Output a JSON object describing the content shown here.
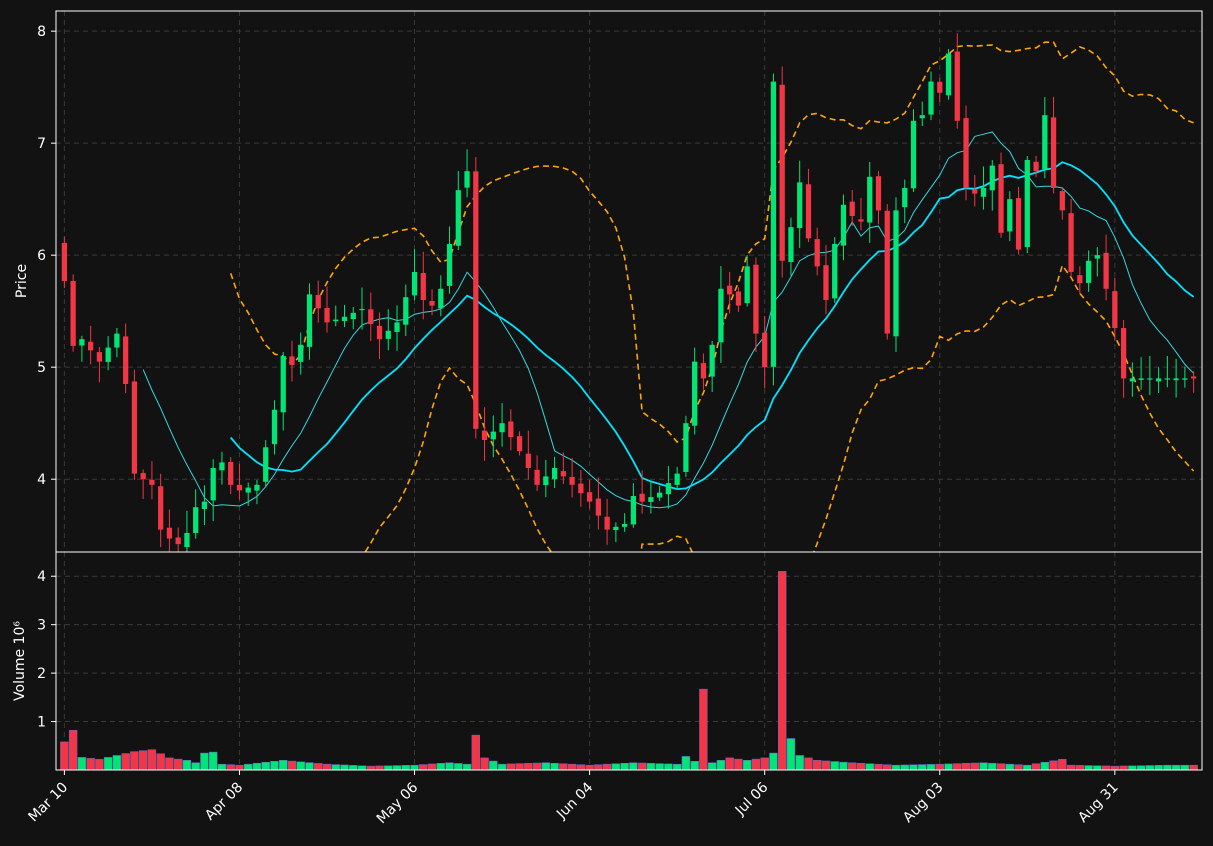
{
  "colors": {
    "background": "#121212",
    "up": "#00e676",
    "down": "#f23645",
    "sma_fast": "#33d6e0",
    "sma_slow": "#00e5ff",
    "bollinger": "#ffa500",
    "grid": "#3a3a3a",
    "text": "#ffffff"
  },
  "chart_data": [
    {
      "type": "candlestick",
      "ylabel": "Price",
      "ylim": [
        3.35,
        8.18
      ],
      "yticks": [
        4,
        5,
        6,
        7,
        8
      ],
      "grid": true,
      "x_count": 130,
      "x_ticks": [
        {
          "index": 0,
          "label": "Mar 10"
        },
        {
          "index": 20,
          "label": "Apr 08"
        },
        {
          "index": 40,
          "label": "May 06"
        },
        {
          "index": 60,
          "label": "Jun 04"
        },
        {
          "index": 80,
          "label": "Jul 06"
        },
        {
          "index": 100,
          "label": "Aug 03"
        },
        {
          "index": 120,
          "label": "Aug 31"
        }
      ],
      "close_anchors": [
        [
          0,
          5.77
        ],
        [
          1,
          5.19
        ],
        [
          2,
          5.25
        ],
        [
          4,
          5.05
        ],
        [
          6,
          5.3
        ],
        [
          7,
          4.85
        ],
        [
          8,
          4.05
        ],
        [
          10,
          3.95
        ],
        [
          11,
          3.55
        ],
        [
          12,
          3.47
        ],
        [
          13,
          3.42
        ],
        [
          14,
          3.52
        ],
        [
          15,
          3.75
        ],
        [
          16,
          3.8
        ],
        [
          17,
          4.1
        ],
        [
          18,
          4.15
        ],
        [
          19,
          3.95
        ],
        [
          20,
          3.9
        ],
        [
          22,
          3.95
        ],
        [
          24,
          4.62
        ],
        [
          25,
          5.1
        ],
        [
          26,
          5.02
        ],
        [
          27,
          5.2
        ],
        [
          28,
          5.65
        ],
        [
          30,
          5.4
        ],
        [
          32,
          5.45
        ],
        [
          34,
          5.52
        ],
        [
          36,
          5.25
        ],
        [
          38,
          5.4
        ],
        [
          40,
          5.85
        ],
        [
          41,
          5.6
        ],
        [
          42,
          5.55
        ],
        [
          43,
          5.7
        ],
        [
          44,
          6.1
        ],
        [
          45,
          6.58
        ],
        [
          46,
          6.75
        ],
        [
          47,
          4.45
        ],
        [
          48,
          4.35
        ],
        [
          50,
          4.5
        ],
        [
          52,
          4.25
        ],
        [
          54,
          3.95
        ],
        [
          56,
          4.1
        ],
        [
          58,
          3.95
        ],
        [
          60,
          3.8
        ],
        [
          62,
          3.55
        ],
        [
          64,
          3.6
        ],
        [
          65,
          3.85
        ],
        [
          66,
          3.8
        ],
        [
          68,
          3.88
        ],
        [
          70,
          4.05
        ],
        [
          71,
          4.5
        ],
        [
          72,
          5.05
        ],
        [
          73,
          4.9
        ],
        [
          74,
          5.2
        ],
        [
          75,
          5.7
        ],
        [
          76,
          5.65
        ],
        [
          77,
          5.55
        ],
        [
          78,
          5.9
        ],
        [
          79,
          5.3
        ],
        [
          80,
          5.0
        ],
        [
          81,
          7.55
        ],
        [
          82,
          5.95
        ],
        [
          83,
          6.25
        ],
        [
          84,
          6.65
        ],
        [
          85,
          6.15
        ],
        [
          86,
          5.9
        ],
        [
          87,
          5.6
        ],
        [
          88,
          6.1
        ],
        [
          89,
          6.45
        ],
        [
          90,
          6.35
        ],
        [
          91,
          6.3
        ],
        [
          92,
          6.7
        ],
        [
          93,
          6.4
        ],
        [
          94,
          5.3
        ],
        [
          95,
          6.4
        ],
        [
          96,
          6.6
        ],
        [
          97,
          7.2
        ],
        [
          98,
          7.25
        ],
        [
          99,
          7.55
        ],
        [
          100,
          7.45
        ],
        [
          101,
          7.8
        ],
        [
          102,
          7.2
        ],
        [
          103,
          6.6
        ],
        [
          104,
          6.55
        ],
        [
          105,
          6.6
        ],
        [
          106,
          6.8
        ],
        [
          107,
          6.2
        ],
        [
          108,
          6.5
        ],
        [
          109,
          6.05
        ],
        [
          110,
          6.85
        ],
        [
          111,
          6.75
        ],
        [
          112,
          7.25
        ],
        [
          113,
          6.6
        ],
        [
          114,
          6.4
        ],
        [
          115,
          5.85
        ],
        [
          116,
          5.75
        ],
        [
          117,
          5.95
        ],
        [
          118,
          6.0
        ],
        [
          119,
          5.7
        ],
        [
          120,
          5.35
        ],
        [
          121,
          4.9
        ]
      ],
      "volume_anchors": [
        [
          0,
          0.58
        ],
        [
          1,
          0.82
        ],
        [
          2,
          0.26
        ],
        [
          4,
          0.22
        ],
        [
          6,
          0.3
        ],
        [
          8,
          0.38
        ],
        [
          10,
          0.42
        ],
        [
          12,
          0.25
        ],
        [
          14,
          0.2
        ],
        [
          15,
          0.15
        ],
        [
          16,
          0.35
        ],
        [
          17,
          0.37
        ],
        [
          18,
          0.12
        ],
        [
          20,
          0.1
        ],
        [
          25,
          0.2
        ],
        [
          30,
          0.12
        ],
        [
          35,
          0.08
        ],
        [
          40,
          0.1
        ],
        [
          44,
          0.15
        ],
        [
          46,
          0.12
        ],
        [
          47,
          0.72
        ],
        [
          48,
          0.25
        ],
        [
          50,
          0.12
        ],
        [
          55,
          0.15
        ],
        [
          60,
          0.1
        ],
        [
          65,
          0.15
        ],
        [
          70,
          0.12
        ],
        [
          71,
          0.28
        ],
        [
          72,
          0.18
        ],
        [
          73,
          1.67
        ],
        [
          74,
          0.15
        ],
        [
          76,
          0.25
        ],
        [
          78,
          0.2
        ],
        [
          80,
          0.25
        ],
        [
          81,
          0.35
        ],
        [
          82,
          4.1
        ],
        [
          83,
          0.65
        ],
        [
          84,
          0.3
        ],
        [
          86,
          0.2
        ],
        [
          90,
          0.15
        ],
        [
          95,
          0.1
        ],
        [
          100,
          0.12
        ],
        [
          105,
          0.15
        ],
        [
          110,
          0.1
        ],
        [
          114,
          0.22
        ],
        [
          115,
          0.1
        ],
        [
          120,
          0.08
        ],
        [
          126,
          0.1
        ],
        [
          129,
          0.1
        ]
      ],
      "volume_ylabel": "Volume  10⁶",
      "volume_ylim": [
        0,
        4.5
      ],
      "volume_yticks": [
        1,
        2,
        3,
        4
      ]
    }
  ]
}
